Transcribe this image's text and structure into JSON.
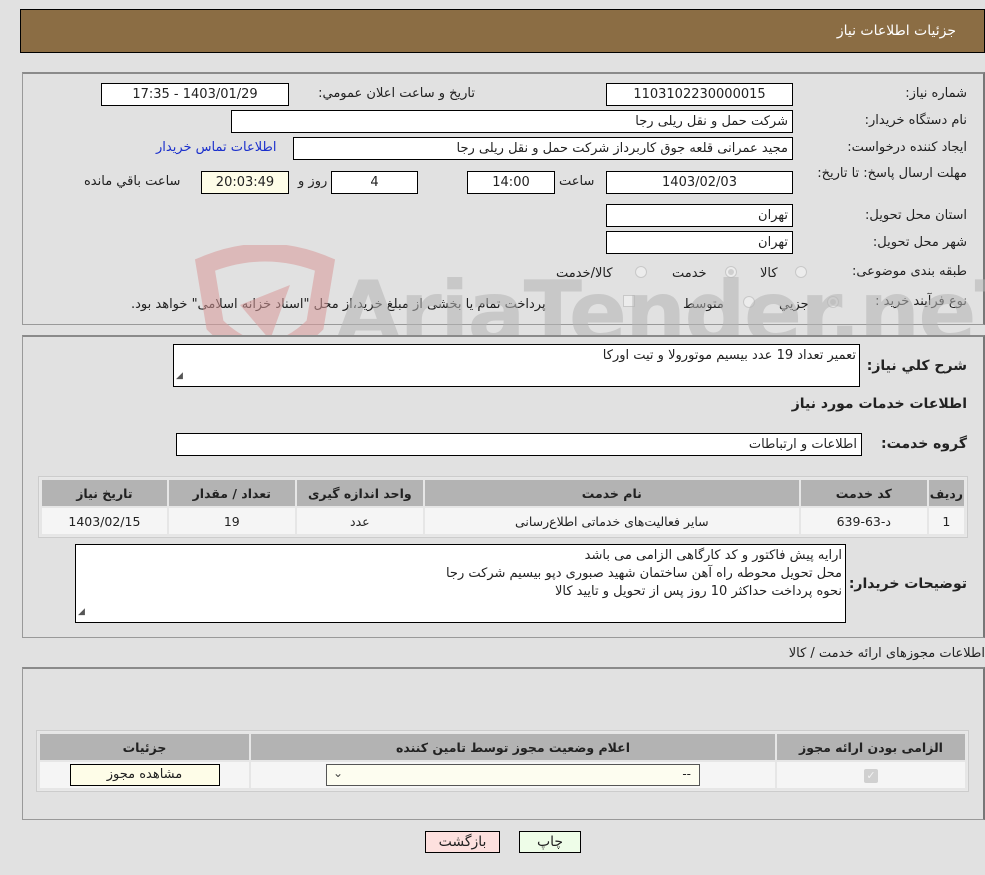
{
  "header": {
    "title": "جزئیات اطلاعات نیاز"
  },
  "details": {
    "need_number_label": "شماره نیاز:",
    "need_number": "1103102230000015",
    "announce_label": "تاریخ و ساعت اعلان عمومي:",
    "announce_value": "1403/01/29 - 17:35",
    "buyer_org_label": "نام دستگاه خريدار:",
    "buyer_org": "شرکت حمل و نقل ریلی رجا",
    "requester_label": "ایجاد کننده درخواست:",
    "requester": "مجید عمرانی قلعه جوق کاربرداز شرکت حمل و نقل ریلی رجا",
    "contact_link": "اطلاعات تماس خريدار",
    "deadline_label": "مهلت ارسال پاسخ: تا تاریخ:",
    "deadline_date": "1403/02/03",
    "time_label": "ساعت",
    "deadline_time": "14:00",
    "days_remaining": "4",
    "days_label": "روز و",
    "time_remaining": "20:03:49",
    "remaining_label": "ساعت باقي مانده",
    "province_label": "استان محل تحویل:",
    "province": "تهران",
    "city_label": "شهر محل تحویل:",
    "city": "تهران",
    "category_label": "طبقه بندی موضوعی:",
    "category_options": [
      {
        "label": "کالا",
        "selected": false
      },
      {
        "label": "خدمت",
        "selected": true
      },
      {
        "label": "کالا/خدمت",
        "selected": false
      }
    ],
    "process_label": "نوع فرآیند خرید :",
    "process_options": [
      {
        "label": "جزيي",
        "selected": true
      },
      {
        "label": "متوسط",
        "selected": false
      }
    ],
    "treasury_note": "پرداخت تمام یا بخشی از مبلغ خرید،از محل \"اسناد خزانه اسلامی\" خواهد بود."
  },
  "watermark": {
    "text": "AriaTender.neT"
  },
  "needs": {
    "summary_label": "شرح كلي نياز:",
    "summary": "تعمیر تعداد 19 عدد بیسیم موتورولا و تیت اورکا",
    "services_heading": "اطلاعات خدمات مورد نیاز",
    "group_label": "گروه خدمت:",
    "group": "اطلاعات و ارتباطات",
    "table": {
      "headers": [
        "ردیف",
        "کد خدمت",
        "نام خدمت",
        "واحد اندازه گیری",
        "تعداد / مقدار",
        "تاریخ نیاز"
      ],
      "rows": [
        [
          "1",
          "د-63-639",
          "سایر فعالیت‌های خدماتی اطلاع‌رسانی",
          "عدد",
          "19",
          "1403/02/15"
        ]
      ]
    },
    "buyer_notes_label": "توضیحات خریدار:",
    "buyer_notes": [
      "ارایه پیش فاکتور و کد کارگاهی الزامی می باشد",
      "محل تحویل محوطه راه آهن ساختمان شهید صبوری دپو بیسیم شرکت رجا",
      "نحوه پرداخت حداکثر 10 روز پس از تحویل و تایید کالا"
    ]
  },
  "permits": {
    "heading": "اطلاعات مجوزهای ارائه خدمت / کالا",
    "headers": [
      "الزامی بودن ارائه مجوز",
      "اعلام وضعیت مجوز توسط تامین کننده",
      "جزئیات"
    ],
    "row": {
      "required_checked": true,
      "status_value": "--",
      "view_button": "مشاهده مجوز"
    }
  },
  "actions": {
    "print": "چاپ",
    "back": "بازگشت"
  }
}
